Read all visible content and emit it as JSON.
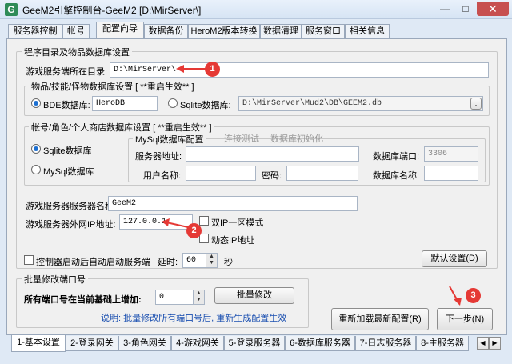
{
  "window": {
    "title": "GeeM2引擎控制台-GeeM2 [D:\\MirServer\\]",
    "min": "—",
    "max": "□",
    "close": "✕"
  },
  "tabs": [
    "服务器控制",
    "帐号",
    "配置向导",
    "数据备份",
    "HeroM2版本转换",
    "数据清理",
    "服务窗口",
    "相关信息"
  ],
  "config": {
    "group_title": "程序目录及物品数据库设置",
    "game_dir_label": "游戏服务端所在目录:",
    "game_dir_value": "D:\\MirServer\\",
    "db_group_title": "物品/技能/怪物数据库设置 [ **重启生效** ]",
    "bde_label": "BDE数据库:",
    "bde_value": "HeroDB",
    "sqlite_label": "Sqlite数据库:",
    "sqlite_value": "D:\\MirServer\\Mud2\\DB\\GEEM2.db",
    "browse": "...",
    "account_group_title": "帐号/角色/个人商店数据库设置 [ **重启生效** ]",
    "acct_sqlite": "Sqlite数据库",
    "acct_mysql": "MySql数据库",
    "mysql_group_title": "MySql数据库配置",
    "test_conn": "连接测试",
    "db_init": "数据库初始化",
    "server_addr_label": "服务器地址:",
    "server_addr_value": "",
    "db_port_label": "数据库端口:",
    "db_port_value": "3306",
    "user_label": "用户名称:",
    "user_value": "",
    "password_label": "密码:",
    "password_value": "",
    "db_name_label": "数据库名称:",
    "db_name_value": "",
    "server_name_label": "游戏服务器服务器名称:",
    "server_name_value": "GeeM2",
    "server_ip_label": "游戏服务器外网IP地址:",
    "server_ip_value": "127.0.0.1",
    "dual_ip": "双IP一区模式",
    "dynamic_ip": "动态IP地址",
    "auto_start": "控制器启动后自动启动服务端",
    "delay_label": "延时:",
    "delay_value": "60",
    "delay_unit": "秒",
    "default_btn": "默认设置(D)",
    "batch_title": "批量修改端口号",
    "batch_label": "所有端口号在当前基础上增加:",
    "batch_value": "0",
    "batch_btn": "批量修改",
    "batch_note": "说明: 批量修改所有端口号后, 重新生成配置生效",
    "reload_btn": "重新加载最新配置(R)",
    "next_btn": "下一步(N)"
  },
  "badges": [
    "1",
    "2",
    "3"
  ],
  "bottom_tabs": [
    "1-基本设置",
    "2-登录网关",
    "3-角色网关",
    "4-游戏网关",
    "5-登录服务器",
    "6-数据库服务器",
    "7-日志服务器",
    "8-主服务器"
  ],
  "nav": {
    "left": "◀",
    "right": "▶"
  }
}
